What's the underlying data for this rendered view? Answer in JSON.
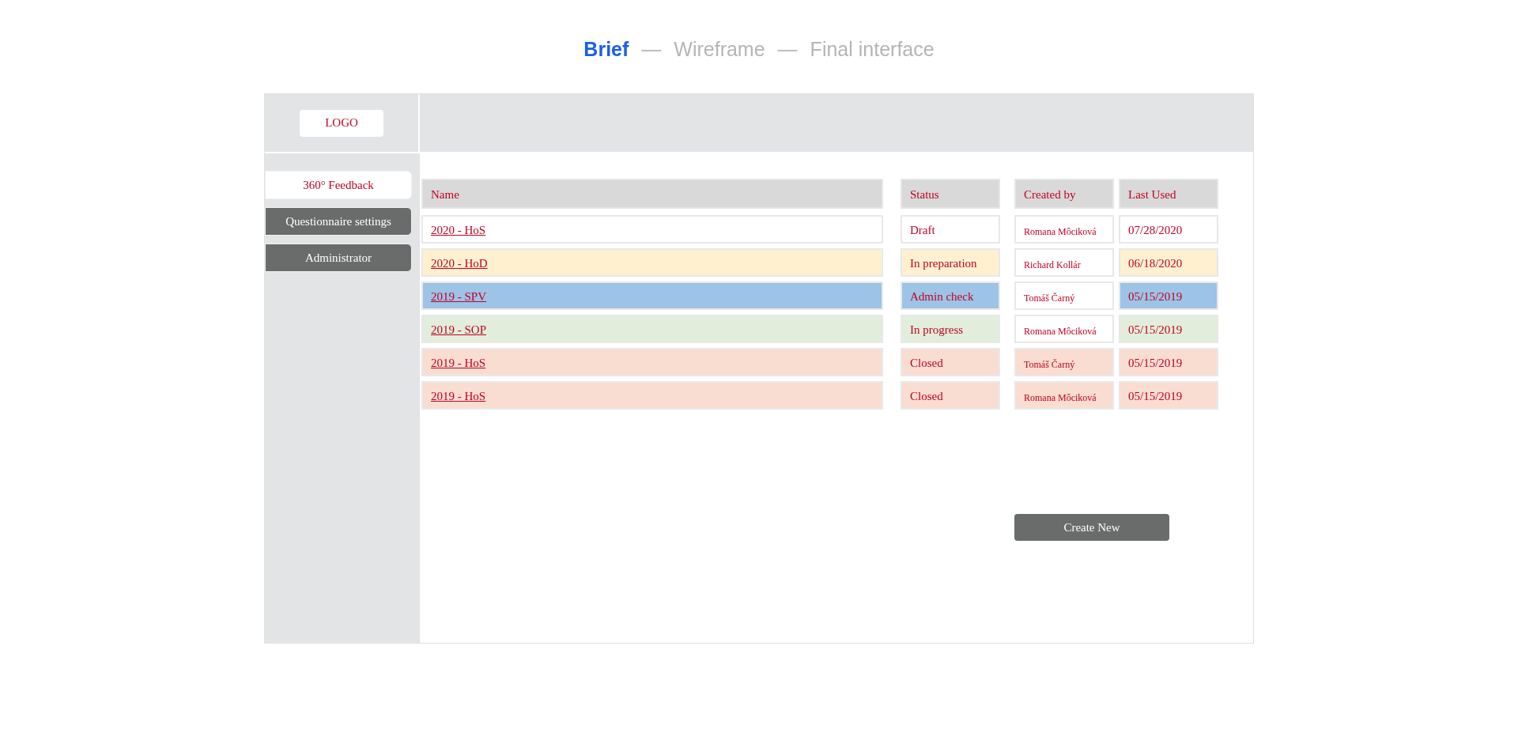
{
  "steps": [
    {
      "label": "Brief",
      "selected": true
    },
    {
      "label": "Wireframe",
      "selected": false
    },
    {
      "label": "Final interface",
      "selected": false
    }
  ],
  "step_separator": "—",
  "logo": "LOGO",
  "sidebar": {
    "items": [
      {
        "label": "360° Feedback",
        "selected": true
      },
      {
        "label": "Questionnaire settings",
        "selected": false
      },
      {
        "label": "Administrator",
        "selected": false
      }
    ]
  },
  "table": {
    "columns": [
      "Name",
      "Status",
      "Created by",
      "Last Used"
    ],
    "rows": [
      {
        "name": "2020 - HoS",
        "status": "Draft",
        "created_by": "Romana Môciková",
        "last_used": "07/28/2020",
        "color": "#ffffff",
        "created_by_highlighted": false
      },
      {
        "name": "2020 - HoD",
        "status": "In preparation",
        "created_by": "Richard Kollár",
        "last_used": "06/18/2020",
        "color": "#fff1d0",
        "created_by_highlighted": false
      },
      {
        "name": "2019 - SPV",
        "status": "Admin check",
        "created_by": "Tomáš Čarný",
        "last_used": "05/15/2019",
        "color": "#9dc3e6",
        "created_by_highlighted": false
      },
      {
        "name": "2019 - SOP",
        "status": "In progress",
        "created_by": "Romana Môciková",
        "last_used": "05/15/2019",
        "color": "#e2eedb",
        "created_by_highlighted": false
      },
      {
        "name": "2019 - HoS",
        "status": "Closed",
        "created_by": "Tomáš Čarný",
        "last_used": "05/15/2019",
        "color": "#f9ddd1",
        "created_by_highlighted": true
      },
      {
        "name": "2019 - HoS",
        "status": "Closed",
        "created_by": "Romana Môciková",
        "last_used": "05/15/2019",
        "color": "#f9ddd1",
        "created_by_highlighted": true
      }
    ]
  },
  "create_button": "Create New"
}
